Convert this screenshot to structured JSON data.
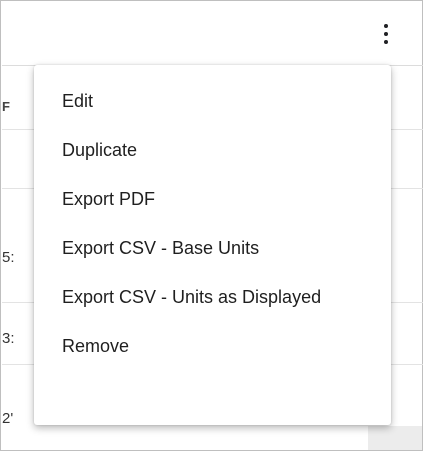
{
  "toolbar": {
    "more_icon": "more-vertical-icon"
  },
  "table": {
    "header_fragment": "F",
    "row_fragments": [
      "",
      "5:",
      "3:",
      "2'"
    ]
  },
  "menu": {
    "items": [
      {
        "label": "Edit"
      },
      {
        "label": "Duplicate"
      },
      {
        "label": "Export PDF"
      },
      {
        "label": "Export CSV - Base Units"
      },
      {
        "label": "Export CSV - Units as Displayed"
      },
      {
        "label": "Remove"
      }
    ]
  }
}
